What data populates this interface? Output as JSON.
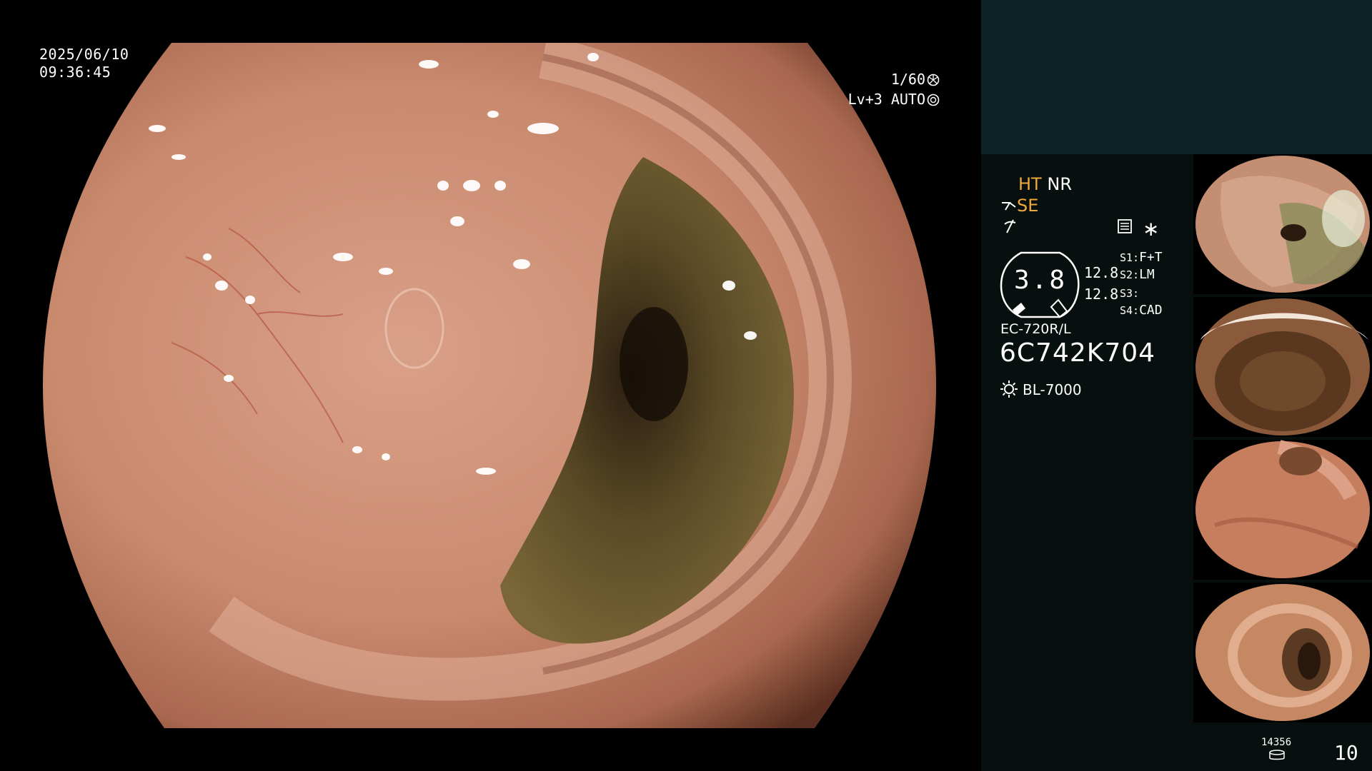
{
  "overlay": {
    "date": "2025/06/10",
    "time": "09:36:45",
    "shutter": "1/60",
    "level_mode": "Lv+3 AUTO"
  },
  "panel": {
    "ht_label": "HT",
    "nr_label": "NR",
    "se_label": "SE",
    "iris_value": "3.8",
    "value_1": "12.8",
    "value_2": "12.8",
    "slots": [
      {
        "key": "S1:",
        "value": "F+T"
      },
      {
        "key": "S2:",
        "value": "LM"
      },
      {
        "key": "S3:",
        "value": ""
      },
      {
        "key": "S4:",
        "value": "CAD"
      }
    ],
    "scope_model": "EC-720R/L",
    "serial_number": "6C742K704",
    "light_source": "BL-7000",
    "image_count_small": "14356",
    "image_count": "10"
  },
  "colors": {
    "accent_orange": "#f0a83a",
    "panel_top": "#0d2426",
    "panel_bg": "#070f0f"
  }
}
